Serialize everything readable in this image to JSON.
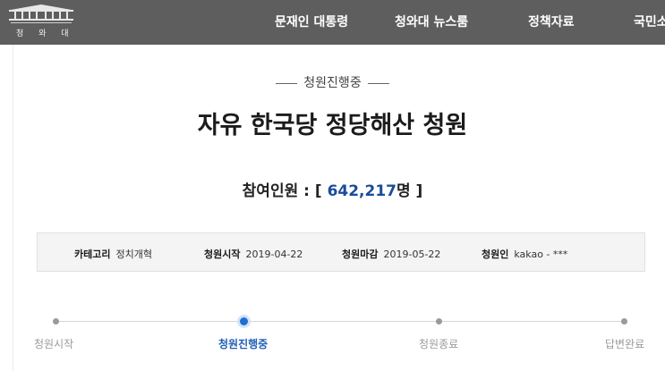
{
  "header": {
    "logo_text": "청 와 대",
    "nav": [
      {
        "label": "문재인 대통령"
      },
      {
        "label": "청와대 뉴스룸"
      },
      {
        "label": "정책자료"
      },
      {
        "label": "국민소"
      }
    ]
  },
  "petition": {
    "status": "청원진행중",
    "title": "자유 한국당 정당해산 청원",
    "participants_label": "참여인원 : [ ",
    "participants_count": "642,217",
    "participants_unit": "명 ]",
    "info": {
      "category_label": "카테고리",
      "category_value": "정치개혁",
      "start_label": "청원시작",
      "start_value": "2019-04-22",
      "end_label": "청원마감",
      "end_value": "2019-05-22",
      "author_label": "청원인",
      "author_value": "kakao - ***"
    },
    "steps": [
      {
        "label": "청원시작"
      },
      {
        "label": "청원진행중"
      },
      {
        "label": "청원종료"
      },
      {
        "label": "답변완료"
      }
    ],
    "active_step": 1
  },
  "colors": {
    "header_bg": "#5e5e5e",
    "accent_blue": "#1b4c9b",
    "active_dot": "#1f6fd1"
  }
}
